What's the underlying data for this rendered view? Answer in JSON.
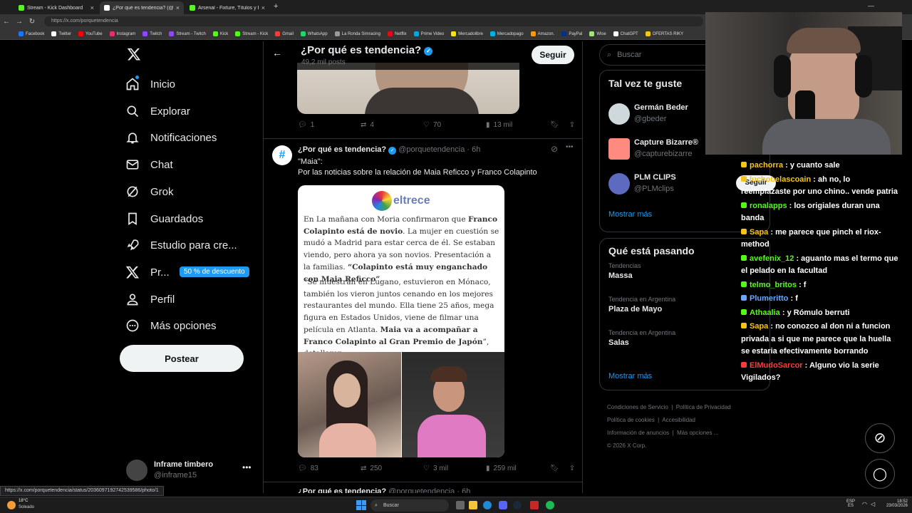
{
  "browser": {
    "tabs": [
      {
        "label": "Stream - Kick Dashboard",
        "color": "#53fc18"
      },
      {
        "label": "¿Por qué es tendencia? (@porque",
        "color": "#ffffff"
      },
      {
        "label": "Arsenal - Fixture, Títulos y Plantel",
        "color": "#53fc18"
      }
    ],
    "url": "https://x.com/porquetendencia",
    "bookmarks": [
      {
        "label": "Facebook",
        "color": "#1877f2"
      },
      {
        "label": "Twitter",
        "color": "#ffffff"
      },
      {
        "label": "YouTube",
        "color": "#ff0000"
      },
      {
        "label": "Instagram",
        "color": "#e1306c"
      },
      {
        "label": "Twitch",
        "color": "#9146ff"
      },
      {
        "label": "Stream - Twitch",
        "color": "#9146ff"
      },
      {
        "label": "Kick",
        "color": "#53fc18"
      },
      {
        "label": "Stream - Kick",
        "color": "#53fc18"
      },
      {
        "label": "Gmail",
        "color": "#ea4335"
      },
      {
        "label": "WhatsApp",
        "color": "#25d366"
      },
      {
        "label": "La Ronda Simracing",
        "color": "#999999"
      },
      {
        "label": "Netflix",
        "color": "#e50914"
      },
      {
        "label": "Prime Video",
        "color": "#00a8e1"
      },
      {
        "label": "Mercadolibre",
        "color": "#ffe600"
      },
      {
        "label": "Mercadopago",
        "color": "#00b1ea"
      },
      {
        "label": "Amazon.",
        "color": "#ff9900"
      },
      {
        "label": "PayPal",
        "color": "#003087"
      },
      {
        "label": "Wise",
        "color": "#9fe870"
      },
      {
        "label": "ChatGPT",
        "color": "#ffffff"
      },
      {
        "label": "OFERTAS RIKY",
        "color": "#f5c518"
      }
    ],
    "status_url": "https://x.com/porquetendencia/status/2036097192742539586/photo/1"
  },
  "nav": {
    "items": [
      {
        "label": "Inicio",
        "icon": "home-icon"
      },
      {
        "label": "Explorar",
        "icon": "search-icon"
      },
      {
        "label": "Notificaciones",
        "icon": "bell-icon"
      },
      {
        "label": "Chat",
        "icon": "mail-icon"
      },
      {
        "label": "Grok",
        "icon": "grok-icon"
      },
      {
        "label": "Guardados",
        "icon": "bookmark-icon"
      },
      {
        "label": "Estudio para cre...",
        "icon": "rocket-icon"
      },
      {
        "label": "Pr...",
        "icon": "x-premium-icon"
      },
      {
        "label": "Perfil",
        "icon": "person-icon"
      },
      {
        "label": "Más opciones",
        "icon": "more-circle-icon"
      }
    ],
    "premium_badge": "50 % de descuento",
    "post_button": "Postear",
    "account": {
      "name": "Inframe timbero",
      "handle": "@inframe15"
    }
  },
  "header": {
    "title": "¿Por qué es tendencia?",
    "posts": "49,2 mil posts",
    "follow": "Seguir"
  },
  "post1": {
    "replies": "1",
    "reposts": "4",
    "likes": "70",
    "views": "13 mil"
  },
  "post2": {
    "name": "¿Por qué es tendencia?",
    "handle": "@porquetendencia",
    "time": "6h",
    "line1": "\"Maia\":",
    "line2": "Por las noticias sobre la relación de Maia Reficco y Franco Colapinto",
    "article": {
      "brand": "eltrece",
      "p1_a": "En La mañana con Moria confirmaron que ",
      "p1_b": "Franco Colapinto está de novio",
      "p1_c": ". La mujer en cuestión se mudó a Madrid para estar cerca de él. Se estaban viendo, pero ahora ya son novios. Presentación a la familias.",
      "p1_quote": "“Colapinto está muy enganchado con Maia Reficco”",
      "p2_a": "“Se muestran en Lugano, estuvieron en Mónaco, también los vieron juntos cenando en los mejores restaurantes del mundo. Ella tiene 25 años, mega figura en Estados Unidos, viene de filmar una película en Atlanta. ",
      "p2_b": "Maia va a acompañar a Franco Colapinto al Gran Premio de Japón",
      "p2_c": "”, detallaron."
    },
    "replies": "83",
    "reposts": "250",
    "likes": "3 mil",
    "views": "259 mil"
  },
  "post3": {
    "name": "¿Por qué es tendencia?",
    "handle": "@porquetendencia",
    "time": "6h"
  },
  "right": {
    "search_placeholder": "Buscar",
    "suggest_title": "Tal vez te guste",
    "suggestions": [
      {
        "name": "Germán Beder",
        "handle": "@gbeder"
      },
      {
        "name": "Capture Bizarre®",
        "handle": "@capturebizarre"
      },
      {
        "name": "PLM CLIPS",
        "handle": "@PLMclips"
      }
    ],
    "follow": "Seguir",
    "show_more": "Mostrar más",
    "trends_title": "Qué está pasando",
    "trends": [
      {
        "context": "Tendencias",
        "name": "Massa"
      },
      {
        "context": "Tendencia en Argentina",
        "name": "Plaza de Mayo"
      },
      {
        "context": "Tendencia en Argentina",
        "name": "Salas"
      }
    ],
    "footer": [
      "Condiciones de Servicio",
      "Política de Privacidad",
      "Política de cookies",
      "Accesibilidad",
      "Información de anuncios",
      "Más opciones ...",
      "© 2026 X Corp."
    ]
  },
  "chat": [
    {
      "name": "pachorra",
      "text": ": y cuanto sale",
      "color": "#f5c518"
    },
    {
      "name": "luchobelascoain",
      "text": ": ah no, lo reemplazaste por uno chino.. vende patria",
      "color": "#f5c518"
    },
    {
      "name": "ronalapps",
      "text": ": los origiales duran una banda",
      "color": "#53fc18"
    },
    {
      "name": "Sapa",
      "text": ": me parece que pinch el riox-method",
      "color": "#f5c518"
    },
    {
      "name": "avefenix_12",
      "text": ": aguanto mas el termo que el pelado en la facultad",
      "color": "#53fc18"
    },
    {
      "name": "telmo_britos",
      "text": ": f",
      "color": "#53fc18"
    },
    {
      "name": "Plumeritto",
      "text": ": f",
      "color": "#6aa9ff"
    },
    {
      "name": "Athaalia",
      "text": ": y Rómulo berruti",
      "color": "#53fc18"
    },
    {
      "name": "Sapa",
      "text": ": no conozco al don ni a funcion privada a si que me parece que la huella se estaria efectivamente borrando",
      "color": "#f5c518"
    },
    {
      "name": "ElMudoSarcor",
      "text": ": Alguno vio la serie Vigilados?",
      "color": "#ff3b3b"
    }
  ],
  "taskbar": {
    "weather_temp": "18°C",
    "weather_text": "Soleado",
    "search": "Buscar",
    "lang1": "ESP",
    "lang2": "ES",
    "time": "18:52",
    "date": "23/03/2026"
  }
}
